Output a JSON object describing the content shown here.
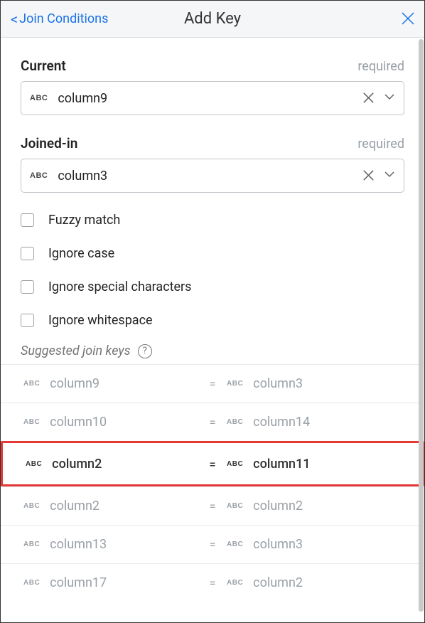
{
  "header": {
    "back_label": "Join Conditions",
    "title": "Add Key"
  },
  "fields": {
    "current": {
      "label": "Current",
      "required": "required",
      "type": "ABC",
      "value": "column9"
    },
    "joined": {
      "label": "Joined-in",
      "required": "required",
      "type": "ABC",
      "value": "column3"
    }
  },
  "options": {
    "fuzzy": "Fuzzy match",
    "ignore_case": "Ignore case",
    "ignore_special": "Ignore special characters",
    "ignore_whitespace": "Ignore whitespace"
  },
  "suggested": {
    "label": "Suggested join keys",
    "rows": [
      {
        "lt": "ABC",
        "lc": "column9",
        "rt": "ABC",
        "rc": "column3",
        "hl": false
      },
      {
        "lt": "ABC",
        "lc": "column10",
        "rt": "ABC",
        "rc": "column14",
        "hl": false
      },
      {
        "lt": "ABC",
        "lc": "column2",
        "rt": "ABC",
        "rc": "column11",
        "hl": true
      },
      {
        "lt": "ABC",
        "lc": "column2",
        "rt": "ABC",
        "rc": "column2",
        "hl": false
      },
      {
        "lt": "ABC",
        "lc": "column13",
        "rt": "ABC",
        "rc": "column3",
        "hl": false
      },
      {
        "lt": "ABC",
        "lc": "column17",
        "rt": "ABC",
        "rc": "column2",
        "hl": false
      }
    ]
  }
}
